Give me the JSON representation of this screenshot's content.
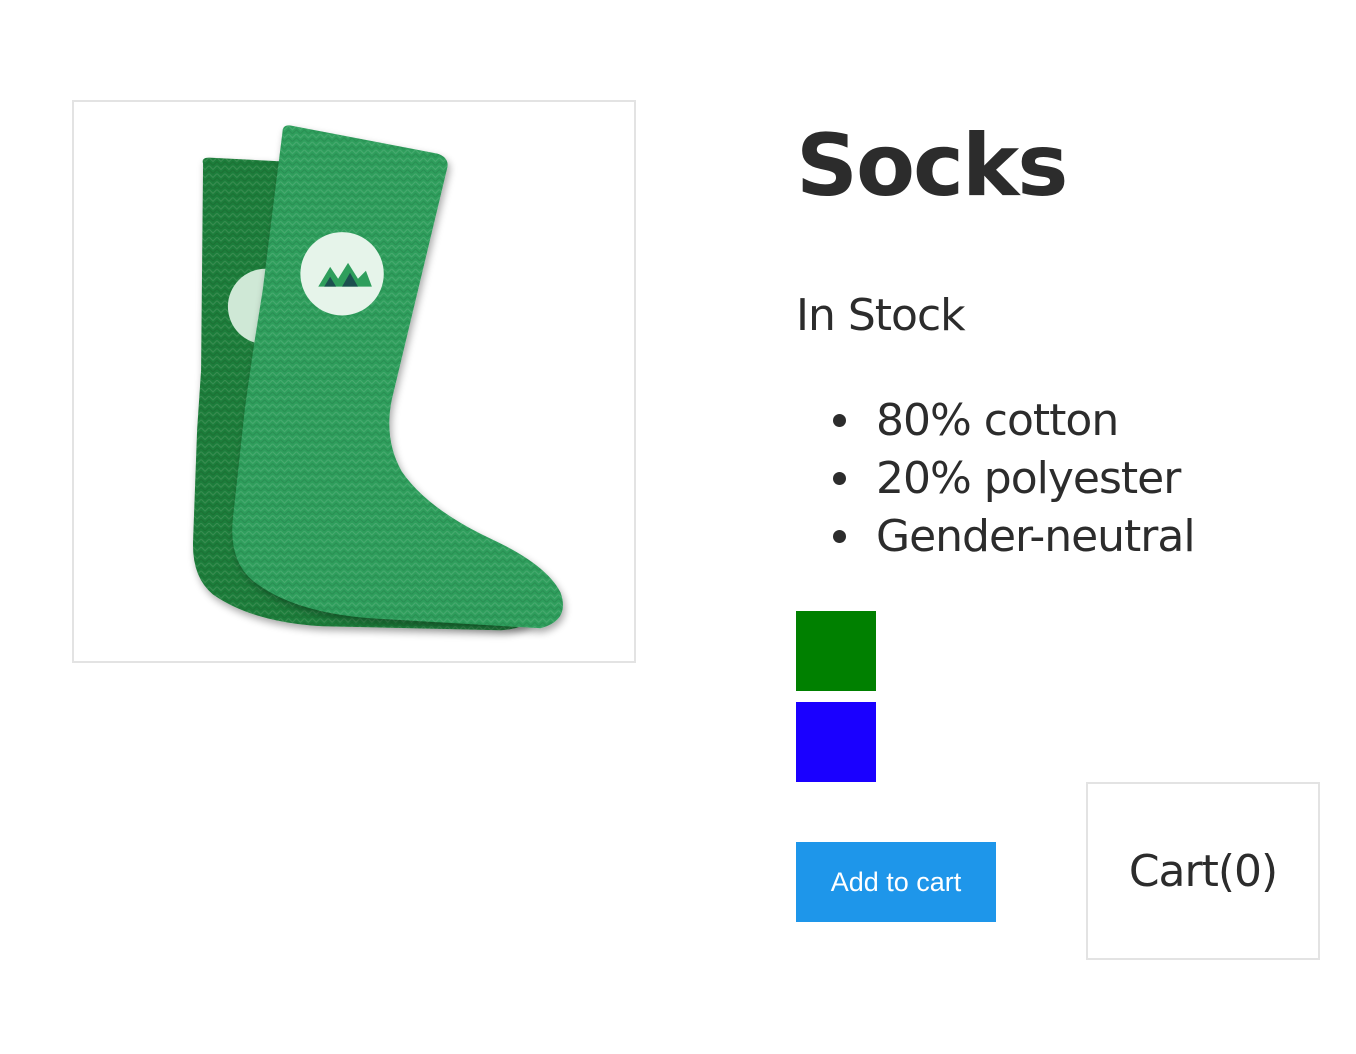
{
  "product": {
    "title": "Socks",
    "stock_status": "In Stock",
    "details": [
      "80% cotton",
      "20% polyester",
      "Gender-neutral"
    ],
    "image_description_icon": "socks-image",
    "variants": [
      {
        "color": "#008000",
        "label": "green"
      },
      {
        "color": "#1a00ff",
        "label": "blue"
      }
    ]
  },
  "actions": {
    "add_to_cart_label": "Add to cart"
  },
  "cart": {
    "label": "Cart(0)"
  }
}
